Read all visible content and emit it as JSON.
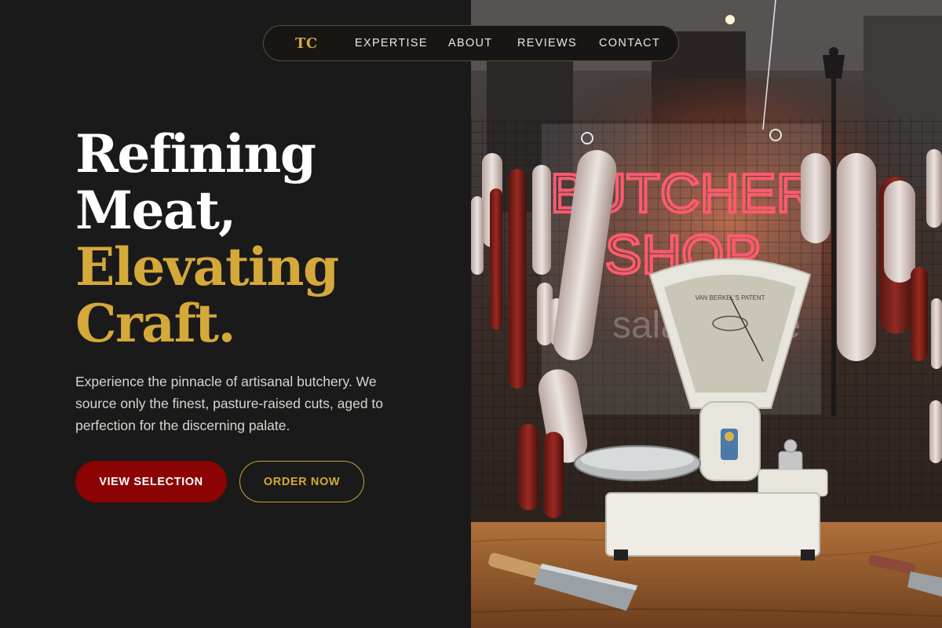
{
  "nav": {
    "logo": "TC",
    "links": [
      "EXPERTISE",
      "ABOUT",
      "REVIEWS",
      "CONTACT"
    ]
  },
  "hero": {
    "headline_line1": "Refining",
    "headline_line2": "Meat,",
    "headline_line3": "Elevating",
    "headline_line4": "Craft.",
    "description": "Experience the pinnacle of artisanal butchery. We source only the finest, pasture-raised cuts, aged to perfection for the discerning palate.",
    "primary_button": "VIEW SELECTION",
    "secondary_button": "ORDER NOW"
  },
  "photo": {
    "neon_line1": "BUTCHER",
    "neon_line2": "SHOP",
    "sign_reflection": "salami love",
    "scale_brand": "VAN BERKEL'S PATENT"
  },
  "colors": {
    "background": "#1b1a1a",
    "accent_gold": "#d4a93a",
    "primary_red": "#8b0303",
    "neon_pink": "#ff5a6e"
  }
}
